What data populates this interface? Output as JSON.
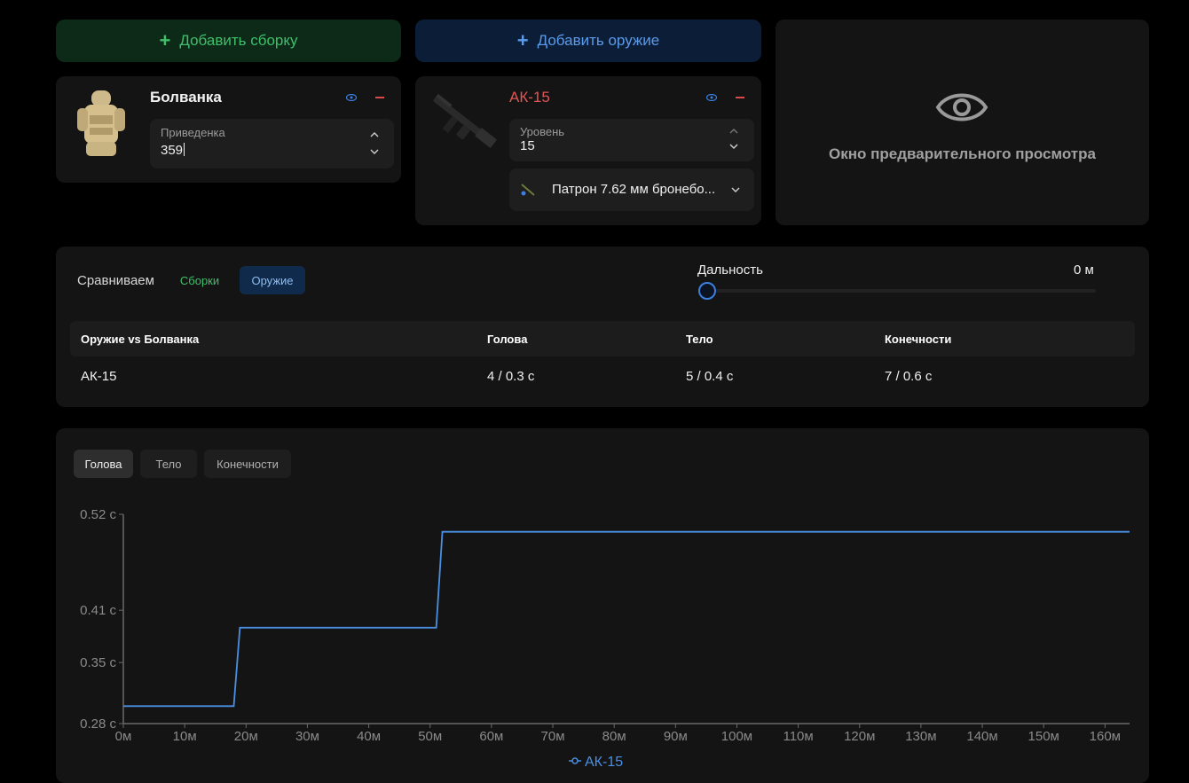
{
  "actions": {
    "add_build": "Добавить сборку",
    "add_weapon": "Добавить оружие"
  },
  "build_card": {
    "title": "Болванка",
    "field_label": "Приведенка",
    "field_value": "359"
  },
  "weapon_card": {
    "title": "АК-15",
    "level_label": "Уровень",
    "level_value": "15",
    "ammo": "Патрон 7.62 мм бронебо..."
  },
  "preview": {
    "text": "Окно предварительного просмотра"
  },
  "compare": {
    "label": "Сравниваем",
    "mode_builds": "Сборки",
    "mode_weapons": "Оружие",
    "active_mode": "Оружие",
    "range_label": "Дальность",
    "range_value": "0 м",
    "range_fraction": 0.0,
    "table": {
      "headers": [
        "Оружие vs Болванка",
        "Голова",
        "Тело",
        "Конечности"
      ],
      "rows": [
        [
          "АК-15",
          "4 / 0.3 с",
          "5 / 0.4 с",
          "7 / 0.6 с"
        ]
      ]
    }
  },
  "chart_tabs": [
    "Голова",
    "Тело",
    "Конечности"
  ],
  "active_tab": "Голова",
  "colors": {
    "series": "#4a90e2",
    "green": "#3fbf6a",
    "blue": "#5b9bea",
    "red": "#e05555"
  },
  "chart_data": {
    "type": "line",
    "x": [
      0,
      18,
      19,
      51,
      52,
      164
    ],
    "series": [
      {
        "name": "АК-15",
        "values": [
          0.3,
          0.3,
          0.39,
          0.39,
          0.5,
          0.5
        ]
      }
    ],
    "ytick_labels": [
      "0.52 с",
      "0.41 с",
      "0.35 с",
      "0.28 с"
    ],
    "ytick_values": [
      0.52,
      0.41,
      0.35,
      0.28
    ],
    "xtick_labels": [
      "0м",
      "10м",
      "20м",
      "30м",
      "40м",
      "50м",
      "60м",
      "70м",
      "80м",
      "90м",
      "100м",
      "110м",
      "120м",
      "130м",
      "140м",
      "150м",
      "160м"
    ],
    "xtick_values": [
      0,
      10,
      20,
      30,
      40,
      50,
      60,
      70,
      80,
      90,
      100,
      110,
      120,
      130,
      140,
      150,
      160
    ],
    "xlim": [
      0,
      164
    ],
    "ylim": [
      0.28,
      0.52
    ],
    "legend": "bottom-center",
    "grid": false
  }
}
